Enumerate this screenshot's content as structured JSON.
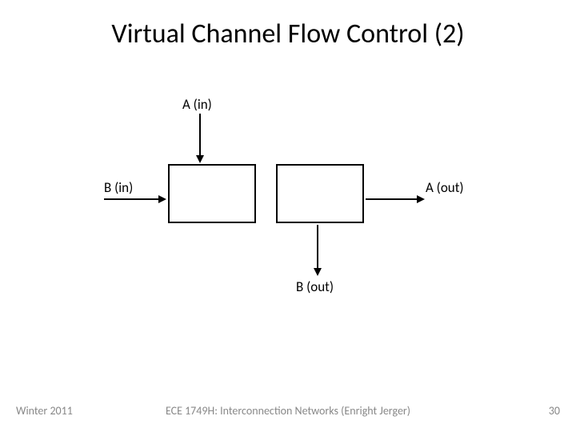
{
  "title": "Virtual Channel Flow Control (2)",
  "labels": {
    "a_in": "A (in)",
    "b_in": "B (in)",
    "a_out": "A (out)",
    "b_out": "B (out)"
  },
  "footer": {
    "left": "Winter 2011",
    "center": "ECE 1749H: Interconnection Networks (Enright Jerger)",
    "right": "30"
  }
}
